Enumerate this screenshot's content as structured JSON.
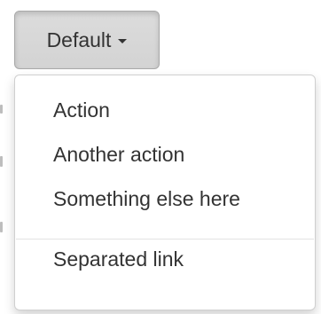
{
  "dropdown": {
    "button_label": "Default",
    "items": [
      {
        "label": "Action"
      },
      {
        "label": "Another action"
      },
      {
        "label": "Something else here"
      }
    ],
    "separated_items": [
      {
        "label": "Separated link"
      }
    ]
  }
}
